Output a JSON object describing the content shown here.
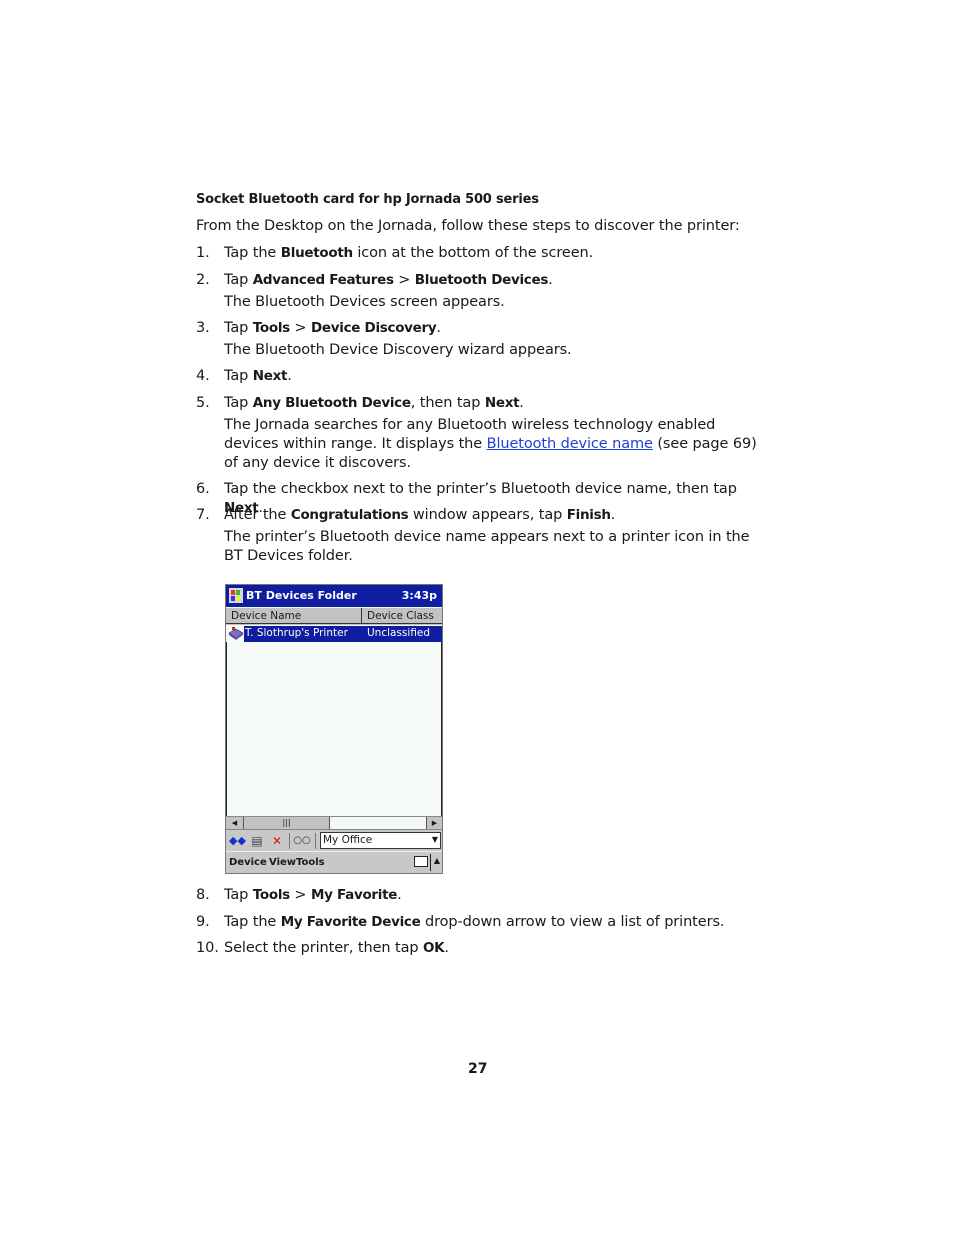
{
  "heading": "Socket Bluetooth card for hp Jornada 500 series",
  "intro": "From the Desktop on the Jornada, follow these steps to discover the printer:",
  "steps": [
    {
      "num": "1.",
      "pre": "Tap the ",
      "b1": "Bluetooth",
      "post": " icon at the bottom of the screen."
    },
    {
      "num": "2.",
      "pre": "Tap ",
      "b1": "Advanced Features",
      "mid": " > ",
      "b2": "Bluetooth Devices",
      "post": ".",
      "note": "The Bluetooth Devices screen appears."
    },
    {
      "num": "3.",
      "pre": "Tap ",
      "b1": "Tools",
      "mid": " > ",
      "b2": "Device Discovery",
      "post": ".",
      "note": "The Bluetooth Device Discovery wizard appears."
    },
    {
      "num": "4.",
      "pre": "Tap ",
      "b1": "Next",
      "post": "."
    },
    {
      "num": "5.",
      "pre": "Tap ",
      "b1": "Any Bluetooth Device",
      "mid": ", then tap ",
      "b2": "Next",
      "post": ".",
      "note_a": "The Jornada searches for any Bluetooth wireless technology enabled devices within range. It displays the ",
      "note_link": "Bluetooth device name",
      "note_b": " (see page 69) of any device it discovers."
    },
    {
      "num": "6.",
      "pre": "Tap the checkbox next to the printer’s Bluetooth device name, then tap ",
      "b1": "Next",
      "post": "."
    },
    {
      "num": "7.",
      "pre": "After the ",
      "b1": "Congratulations",
      "mid": " window appears, tap ",
      "b2": "Finish",
      "post": ".",
      "note": "The printer’s Bluetooth device name appears next to a printer icon in the BT Devices folder."
    },
    {
      "num": "8.",
      "pre": "Tap ",
      "b1": "Tools",
      "mid": " > ",
      "b2": "My Favorite",
      "post": "."
    },
    {
      "num": "9.",
      "pre": "Tap the ",
      "b1": "My Favorite Device",
      "post": " drop-down arrow to view a list of printers."
    },
    {
      "num": "10.",
      "pre": "Select the printer, then tap ",
      "b1": "OK",
      "post": "."
    }
  ],
  "pda": {
    "title": "BT Devices Folder",
    "time": "3:43p",
    "columns": [
      "Device Name",
      "Device Class"
    ],
    "rows": [
      {
        "name": "T. Slothrup's Printer",
        "class": "Unclassified",
        "icon": "printer-icon"
      }
    ],
    "toolbar_icons": [
      "connect-icon",
      "properties-icon",
      "delete-icon",
      "favorite-glasses-icon"
    ],
    "combo_value": "My Office",
    "menus": [
      "Device",
      "View",
      "Tools"
    ],
    "colors": {
      "titlebar": "#0f1ea0",
      "selection": "#0f1ea0",
      "chrome": "#c8c8c8"
    }
  },
  "page_number": "27"
}
